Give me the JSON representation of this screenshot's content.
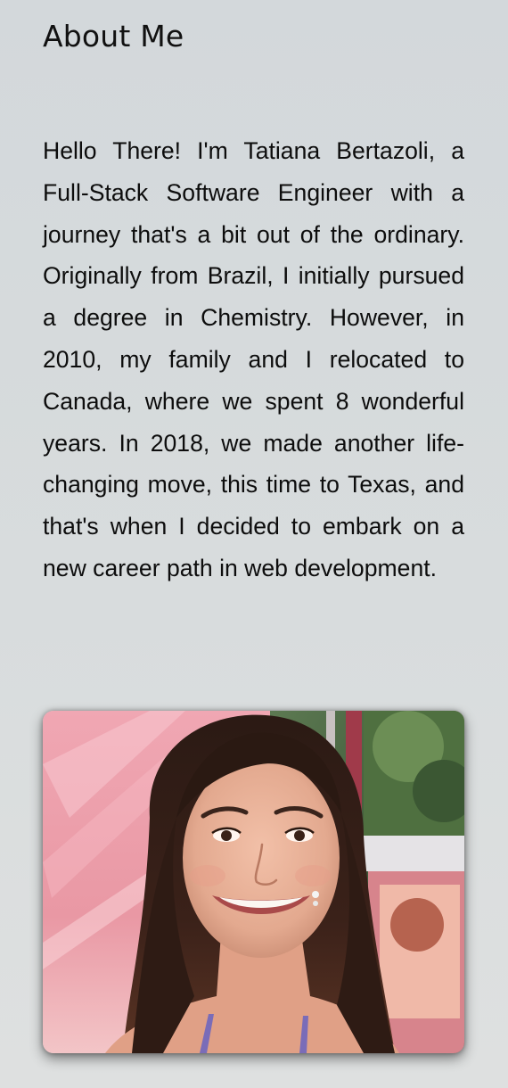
{
  "about": {
    "title": "About Me",
    "bio": "Hello There! I'm Tatiana Bertazoli, a Full-Stack Software Engineer with a journey that's a bit out of the ordinary. Originally from Brazil, I initially pursued a degree in Chemistry. However, in 2010, my family and I relocated to Canada, where we spent 8 wonderful years. In 2018, we made another life-changing move, this time to Texas, and that's when I decided to embark on a new career path in web development."
  },
  "photo": {
    "subject": "portrait photo of a smiling woman with long dark hair"
  }
}
